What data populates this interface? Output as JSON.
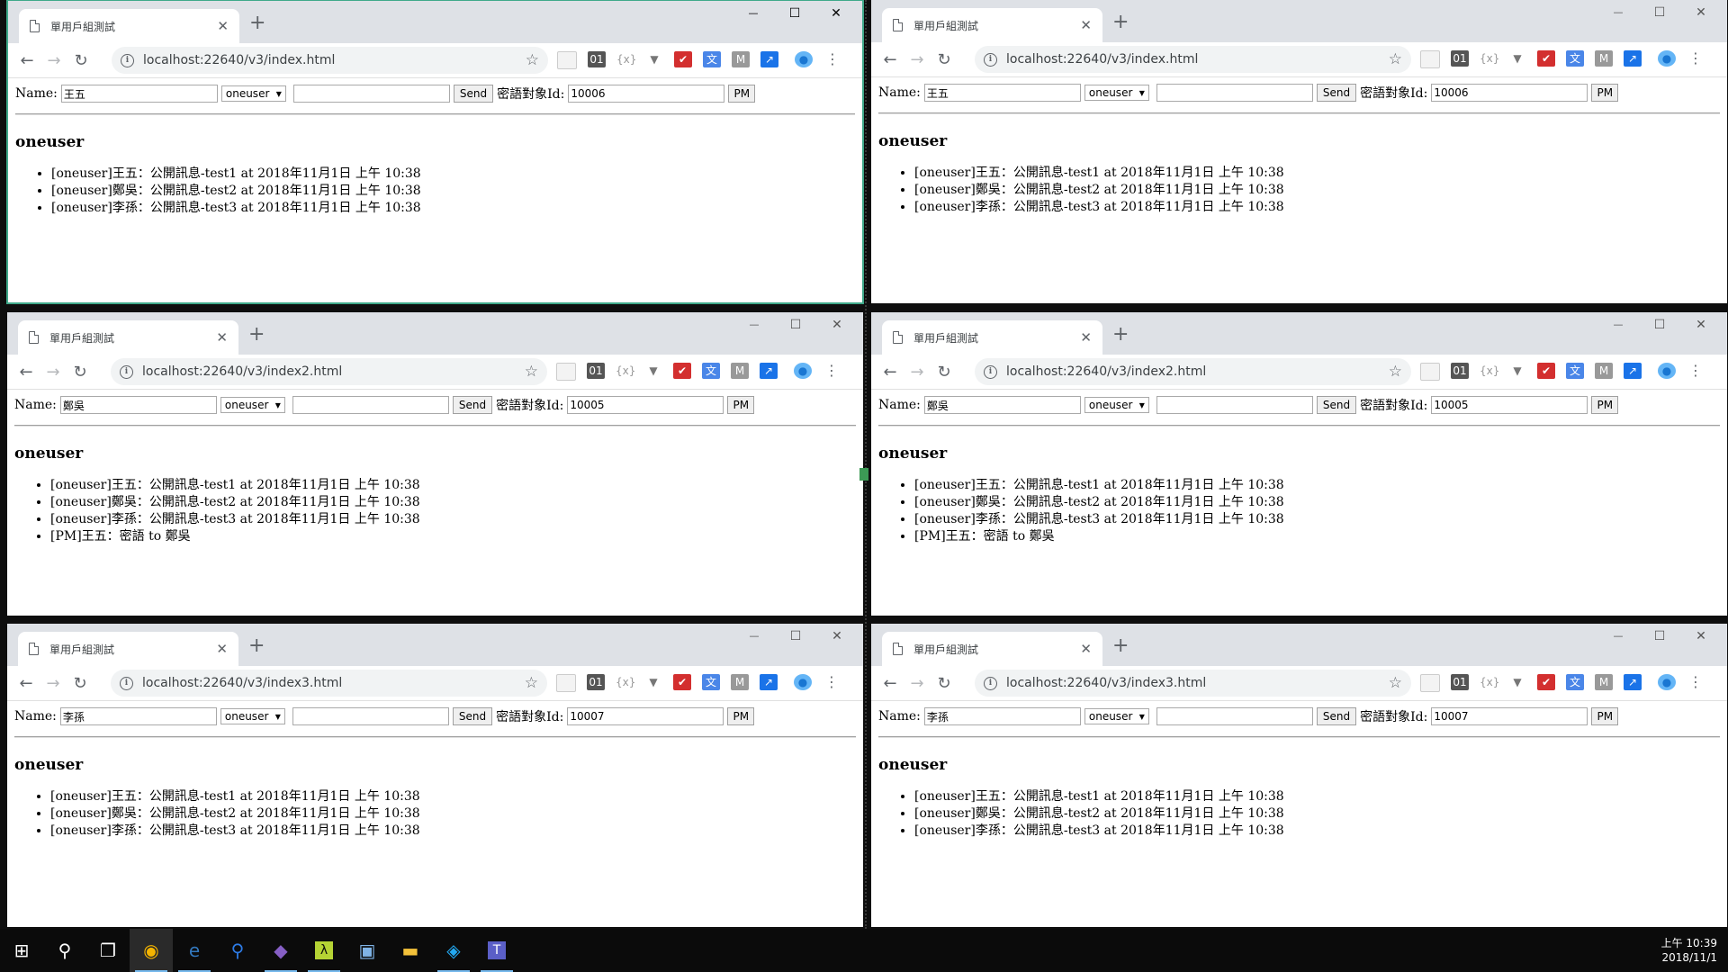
{
  "windows": [
    {
      "tab_title": "單用戶組測試",
      "url": "localhost:22640/v3/index.html",
      "name": "王五",
      "group": "oneuser",
      "message": "",
      "send_label": "Send",
      "pm_label_text": "密語對象Id:",
      "pm_target_id": "10006",
      "pm_button": "PM",
      "room_title": "oneuser",
      "messages": [
        "[oneuser]王五：公開訊息-test1 at 2018年11月1日 上午 10:38",
        "[oneuser]鄭吳：公開訊息-test2 at 2018年11月1日 上午 10:38",
        "[oneuser]李孫：公開訊息-test3 at 2018年11月1日 上午 10:38"
      ]
    },
    {
      "tab_title": "單用戶組測試",
      "url": "localhost:22640/v3/index.html",
      "name": "王五",
      "group": "oneuser",
      "message": "",
      "send_label": "Send",
      "pm_label_text": "密語對象Id:",
      "pm_target_id": "10006",
      "pm_button": "PM",
      "room_title": "oneuser",
      "messages": [
        "[oneuser]王五：公開訊息-test1 at 2018年11月1日 上午 10:38",
        "[oneuser]鄭吳：公開訊息-test2 at 2018年11月1日 上午 10:38",
        "[oneuser]李孫：公開訊息-test3 at 2018年11月1日 上午 10:38"
      ]
    },
    {
      "tab_title": "單用戶組測試",
      "url": "localhost:22640/v3/index2.html",
      "name": "鄭吳",
      "group": "oneuser",
      "message": "",
      "send_label": "Send",
      "pm_label_text": "密語對象Id:",
      "pm_target_id": "10005",
      "pm_button": "PM",
      "room_title": "oneuser",
      "messages": [
        "[oneuser]王五：公開訊息-test1 at 2018年11月1日 上午 10:38",
        "[oneuser]鄭吳：公開訊息-test2 at 2018年11月1日 上午 10:38",
        "[oneuser]李孫：公開訊息-test3 at 2018年11月1日 上午 10:38",
        "[PM]王五：密語 to 鄭吳"
      ]
    },
    {
      "tab_title": "單用戶組測試",
      "url": "localhost:22640/v3/index2.html",
      "name": "鄭吳",
      "group": "oneuser",
      "message": "",
      "send_label": "Send",
      "pm_label_text": "密語對象Id:",
      "pm_target_id": "10005",
      "pm_button": "PM",
      "room_title": "oneuser",
      "messages": [
        "[oneuser]王五：公開訊息-test1 at 2018年11月1日 上午 10:38",
        "[oneuser]鄭吳：公開訊息-test2 at 2018年11月1日 上午 10:38",
        "[oneuser]李孫：公開訊息-test3 at 2018年11月1日 上午 10:38",
        "[PM]王五：密語 to 鄭吳"
      ]
    },
    {
      "tab_title": "單用戶組測試",
      "url": "localhost:22640/v3/index3.html",
      "name": "李孫",
      "group": "oneuser",
      "message": "",
      "send_label": "Send",
      "pm_label_text": "密語對象Id:",
      "pm_target_id": "10007",
      "pm_button": "PM",
      "room_title": "oneuser",
      "messages": [
        "[oneuser]王五：公開訊息-test1 at 2018年11月1日 上午 10:38",
        "[oneuser]鄭吳：公開訊息-test2 at 2018年11月1日 上午 10:38",
        "[oneuser]李孫：公開訊息-test3 at 2018年11月1日 上午 10:38"
      ]
    },
    {
      "tab_title": "單用戶組測試",
      "url": "localhost:22640/v3/index3.html",
      "name": "李孫",
      "group": "oneuser",
      "message": "",
      "send_label": "Send",
      "pm_label_text": "密語對象Id:",
      "pm_target_id": "10007",
      "pm_button": "PM",
      "room_title": "oneuser",
      "messages": [
        "[oneuser]王五：公開訊息-test1 at 2018年11月1日 上午 10:38",
        "[oneuser]鄭吳：公開訊息-test2 at 2018年11月1日 上午 10:38",
        "[oneuser]李孫：公開訊息-test3 at 2018年11月1日 上午 10:38"
      ]
    }
  ],
  "name_label": "Name:",
  "taskbar": {
    "apps": [
      "windows-start-icon",
      "search-icon",
      "task-view-icon",
      "chrome-icon",
      "edge-icon",
      "maps-icon",
      "visual-studio-icon",
      "lambda-app-icon",
      "remote-desktop-icon",
      "file-explorer-icon",
      "vscode-icon",
      "teams-icon"
    ],
    "clock_time": "上午 10:39",
    "clock_date": "2018/11/1"
  }
}
